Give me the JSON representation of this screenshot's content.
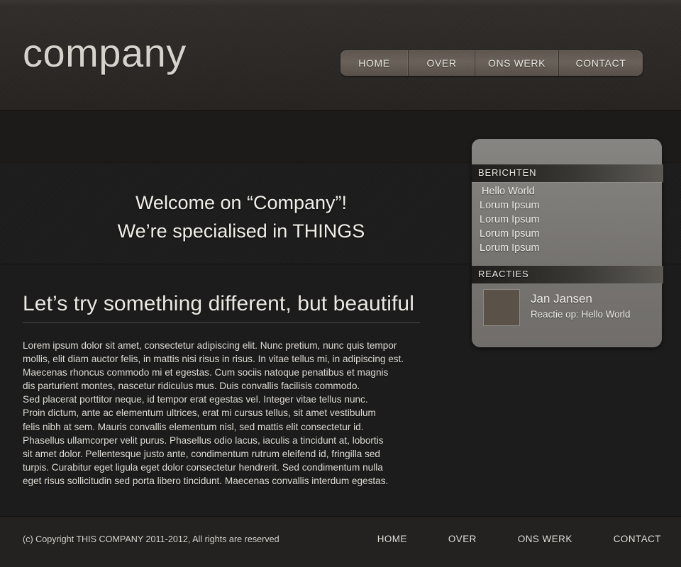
{
  "site": {
    "logo": "company"
  },
  "nav": {
    "items": [
      {
        "label": "HOME"
      },
      {
        "label": "OVER"
      },
      {
        "label": "ONS WERK"
      },
      {
        "label": "CONTACT"
      }
    ]
  },
  "banner": {
    "line1": "Welcome on “Company”!",
    "line2": "We’re specialised in THINGS"
  },
  "article": {
    "title": "Let’s try something different, but beautiful",
    "body": "Lorem ipsum dolor sit amet, consectetur adipiscing elit. Nunc pretium, nunc quis tempor\nmollis, elit diam auctor felis, in mattis nisi risus in risus. In vitae tellus mi, in adipiscing est.\nMaecenas rhoncus commodo mi et egestas. Cum sociis natoque penatibus et magnis\ndis parturient montes, nascetur ridiculus mus. Duis convallis facilisis commodo.\nSed placerat porttitor neque, id tempor erat egestas vel. Integer vitae tellus nunc.\nProin dictum, ante ac elementum ultrices, erat mi cursus tellus, sit amet vestibulum\nfelis nibh at sem. Mauris convallis elementum nisl, sed mattis elit consectetur id.\nPhasellus ullamcorper velit purus. Phasellus odio lacus, iaculis a tincidunt at, lobortis\n sit amet dolor. Pellentesque justo ante, condimentum rutrum eleifend id, fringilla sed\nturpis. Curabitur eget ligula eget dolor consectetur hendrerit. Sed condimentum nulla\neget risus sollicitudin sed porta libero tincidunt. Maecenas convallis interdum egestas."
  },
  "sidebar": {
    "berichten": {
      "header": "BERICHTEN",
      "items": [
        {
          "label": "Hello World"
        },
        {
          "label": "Lorum Ipsum"
        },
        {
          "label": "Lorum Ipsum"
        },
        {
          "label": "Lorum Ipsum"
        },
        {
          "label": "Lorum Ipsum"
        }
      ]
    },
    "reacties": {
      "header": "REACTIES",
      "entry": {
        "name": "Jan Jansen",
        "subject": "Reactie op: Hello World",
        "avatar_color": "#5a5149"
      }
    }
  },
  "footer": {
    "copyright": "(c) Copyright THIS COMPANY 2011-2012, All rights are reserved",
    "links": [
      {
        "label": "HOME"
      },
      {
        "label": "OVER"
      },
      {
        "label": "ONS WERK"
      },
      {
        "label": "CONTACT"
      }
    ]
  },
  "theme": {
    "header_bg": "#2b2825",
    "banner_bg": "#4a4540",
    "content_bg": "#1c1c1c",
    "footer_bg": "#232220",
    "nav_bg": "#6a625a",
    "text_light": "#ece9e3"
  }
}
